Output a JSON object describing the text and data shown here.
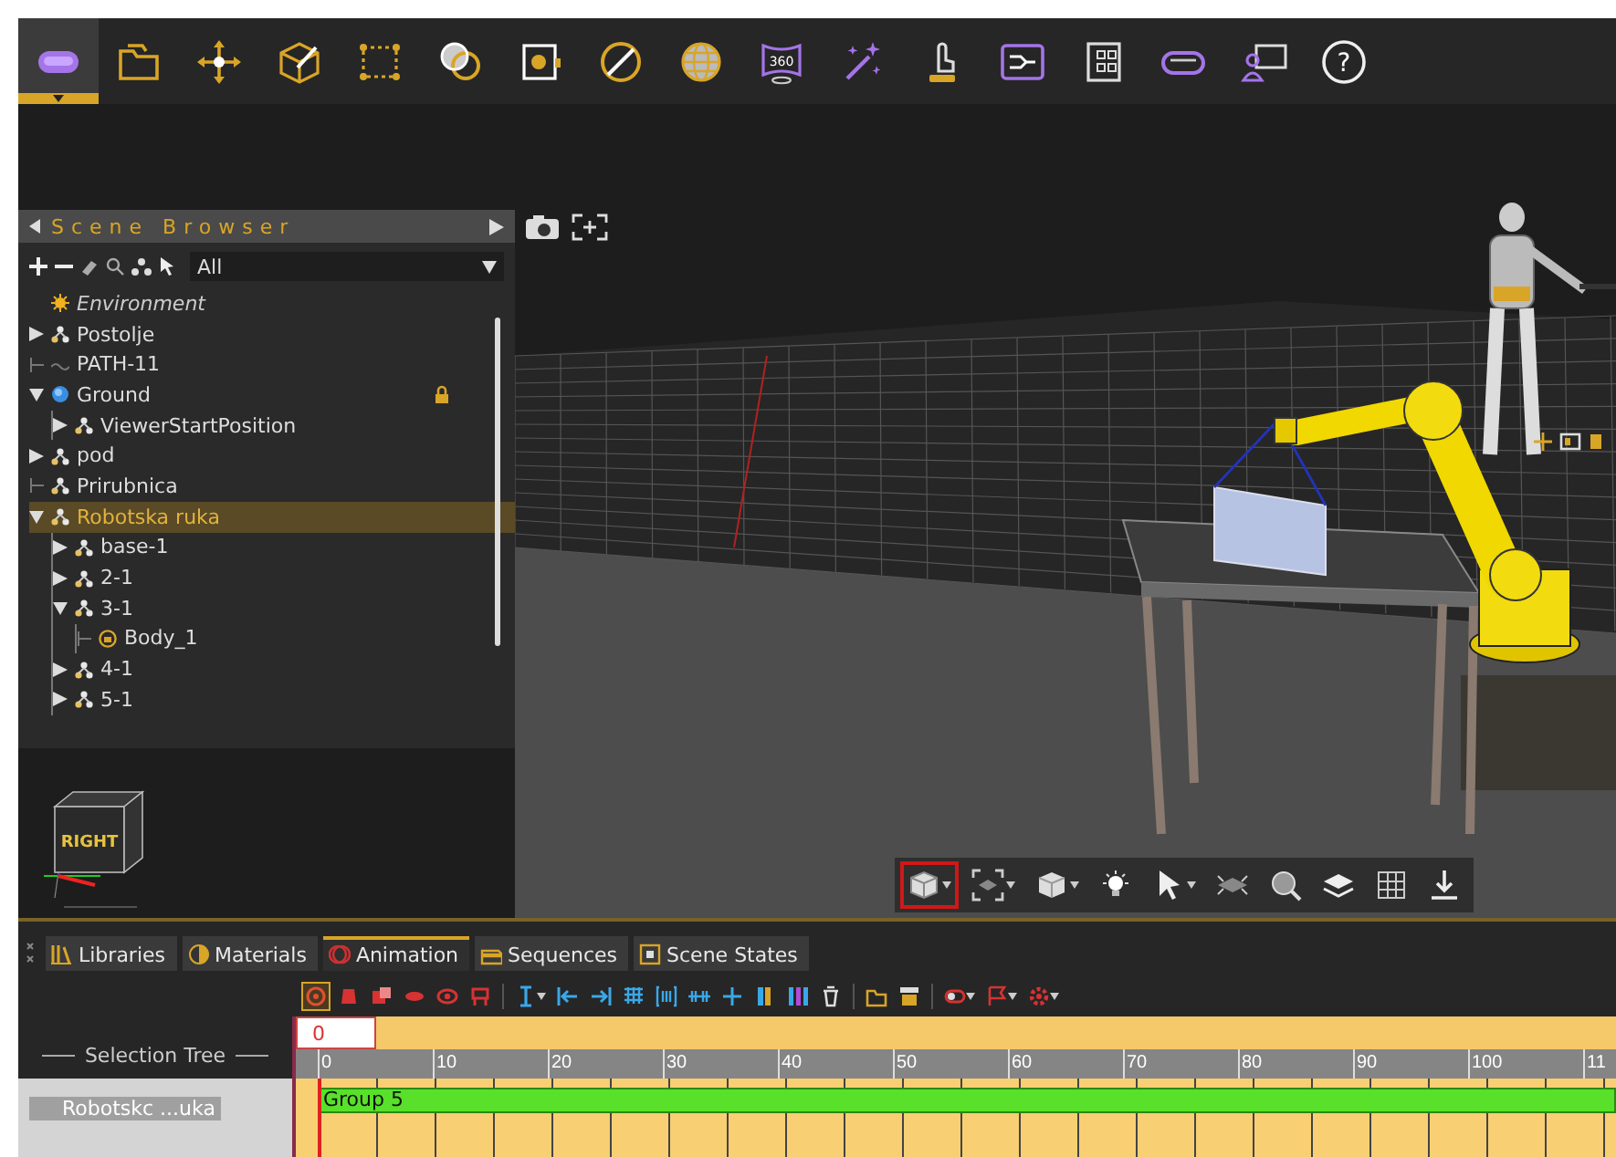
{
  "toolbar": {
    "buttons": [
      {
        "selected": true
      },
      {
        "selected": false
      },
      {
        "selected": false
      },
      {
        "selected": false
      },
      {
        "selected": false
      },
      {
        "selected": false
      },
      {
        "selected": false
      },
      {
        "selected": false
      },
      {
        "selected": false
      },
      {
        "selected": false,
        "text": "360"
      },
      {
        "selected": false
      },
      {
        "selected": false
      },
      {
        "selected": false
      },
      {
        "selected": false
      },
      {
        "selected": false
      },
      {
        "selected": false
      },
      {
        "selected": false,
        "text": "?"
      }
    ]
  },
  "scene_browser": {
    "title": "Scene Browser",
    "filter": "All",
    "tree": [
      {
        "label": "Environment",
        "kind": "environment",
        "selected": false,
        "locked": false
      },
      {
        "label": "Postolje",
        "kind": "group",
        "expanded": false,
        "selected": false,
        "locked": false
      },
      {
        "label": "PATH-11",
        "kind": "path",
        "selected": false,
        "locked": false
      },
      {
        "label": "Ground",
        "kind": "ground",
        "expanded": true,
        "selected": false,
        "locked": true,
        "children": [
          {
            "label": "ViewerStartPosition",
            "kind": "group",
            "expanded": false,
            "selected": false,
            "locked": false
          }
        ]
      },
      {
        "label": "pod",
        "kind": "group",
        "expanded": false,
        "selected": false,
        "locked": false
      },
      {
        "label": "Prirubnica",
        "kind": "node",
        "selected": false,
        "locked": false
      },
      {
        "label": "Robotska ruka",
        "kind": "group",
        "expanded": true,
        "selected": true,
        "locked": false,
        "children": [
          {
            "label": "base-1",
            "kind": "group",
            "expanded": false,
            "selected": false,
            "locked": false
          },
          {
            "label": "2-1",
            "kind": "group",
            "expanded": false,
            "selected": false,
            "locked": false
          },
          {
            "label": "3-1",
            "kind": "group",
            "expanded": true,
            "selected": false,
            "locked": false,
            "children": [
              {
                "label": "Body_1",
                "kind": "mesh",
                "selected": false,
                "locked": false
              }
            ]
          },
          {
            "label": "4-1",
            "kind": "group",
            "expanded": false,
            "selected": false,
            "locked": false
          },
          {
            "label": "5-1",
            "kind": "group",
            "expanded": false,
            "selected": false,
            "locked": false
          }
        ]
      }
    ]
  },
  "viewport": {
    "view_cube": {
      "label": "RIGHT"
    },
    "tools": [
      {
        "selected": true,
        "dropdown": true
      },
      {
        "selected": false,
        "dropdown": true
      },
      {
        "selected": false,
        "dropdown": true
      },
      {
        "selected": false,
        "dropdown": false
      },
      {
        "selected": false,
        "dropdown": true
      },
      {
        "selected": false,
        "dropdown": false
      },
      {
        "selected": false,
        "dropdown": false
      },
      {
        "selected": false,
        "dropdown": false
      },
      {
        "selected": false,
        "dropdown": false
      },
      {
        "selected": false,
        "dropdown": false
      }
    ]
  },
  "bottom_tabs": [
    {
      "label": "Libraries",
      "selected": false
    },
    {
      "label": "Materials",
      "selected": false
    },
    {
      "label": "Animation",
      "selected": true
    },
    {
      "label": "Sequences",
      "selected": false
    },
    {
      "label": "Scene States",
      "selected": false
    }
  ],
  "animation": {
    "tools": [
      {
        "selected": true,
        "dropdown": false
      },
      {
        "selected": false,
        "dropdown": false
      },
      {
        "selected": false,
        "dropdown": false
      },
      {
        "selected": false,
        "dropdown": false
      },
      {
        "selected": false,
        "dropdown": false
      },
      {
        "selected": false,
        "dropdown": false
      },
      {
        "selected": false,
        "dropdown": true
      },
      {
        "selected": false,
        "dropdown": false
      },
      {
        "selected": false,
        "dropdown": false
      },
      {
        "selected": false,
        "dropdown": false
      },
      {
        "selected": false,
        "dropdown": false
      },
      {
        "selected": false,
        "dropdown": false
      },
      {
        "selected": false,
        "dropdown": false
      },
      {
        "selected": false,
        "dropdown": false
      },
      {
        "selected": false,
        "dropdown": false
      },
      {
        "selected": false,
        "dropdown": false
      },
      {
        "selected": false,
        "dropdown": false
      },
      {
        "selected": false,
        "dropdown": false
      },
      {
        "selected": false,
        "dropdown": true
      },
      {
        "selected": false,
        "dropdown": true
      },
      {
        "selected": false,
        "dropdown": true
      }
    ],
    "selection_tree_label": "Selection Tree",
    "current_frame": "0",
    "ruler": [
      "0",
      "10",
      "20",
      "30",
      "40",
      "50",
      "60",
      "70",
      "80",
      "90",
      "100",
      "11"
    ],
    "tracks": [
      {
        "label": "Robotskc ...uka",
        "selected": true,
        "clip": "Group 5"
      }
    ]
  }
}
